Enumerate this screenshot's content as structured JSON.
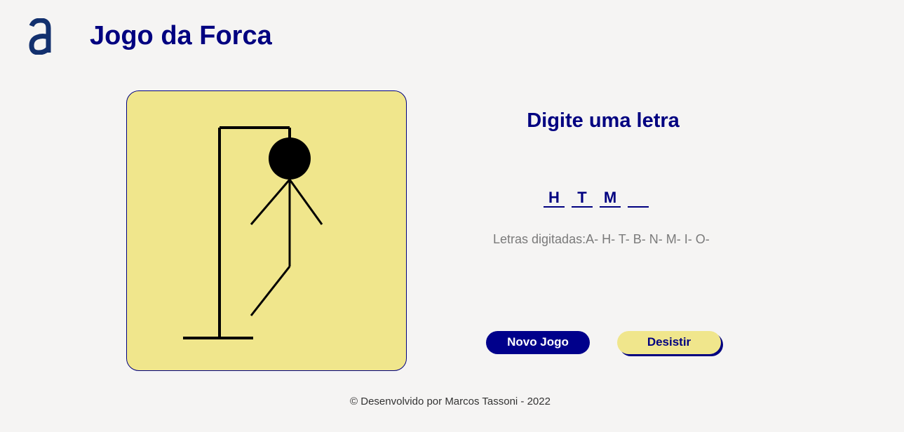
{
  "header": {
    "logo_icon": "letter-a-logo-icon",
    "title": "Jogo da Forca"
  },
  "game": {
    "prompt": "Digite uma letra",
    "word_slots": [
      "H",
      "T",
      "M",
      ""
    ],
    "typed_letters": "Letras digitadas:A- H- T- B- N- M- I- O-",
    "hangman_parts_visible": [
      "head",
      "body",
      "left-arm",
      "right-arm",
      "left-leg"
    ]
  },
  "buttons": {
    "new_game": "Novo Jogo",
    "give_up": "Desistir"
  },
  "footer": {
    "text": "© Desenvolvido por Marcos Tassoni - 2022"
  },
  "colors": {
    "accent": "#000080",
    "board": "#f0e68c",
    "background": "#f5f4f3"
  }
}
